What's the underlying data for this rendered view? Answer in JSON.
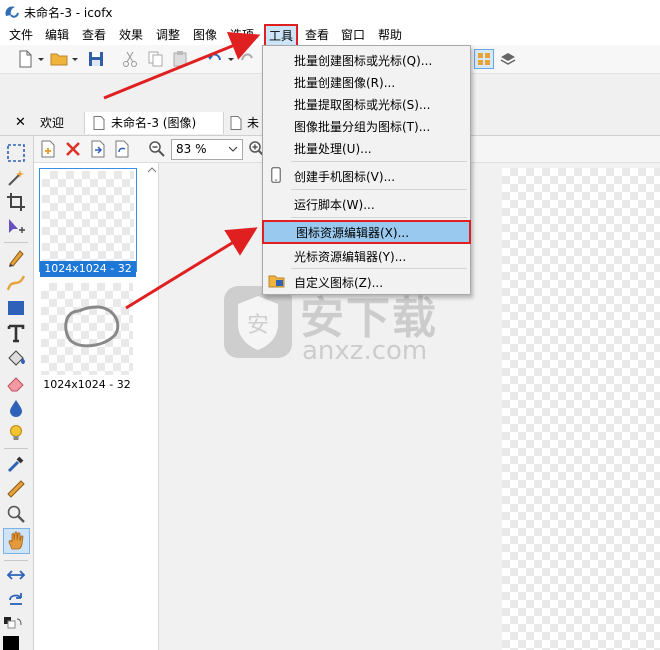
{
  "window": {
    "title": "未命名-3 - icofx"
  },
  "menubar": {
    "items": [
      "文件",
      "编辑",
      "查看",
      "效果",
      "调整",
      "图像",
      "选项",
      "工具",
      "查看",
      "窗口",
      "帮助"
    ]
  },
  "tabs": {
    "close_label": "✕",
    "welcome": "欢迎",
    "doc1": "未命名-3 (图像)",
    "doc2": "未"
  },
  "doc_toolbar": {
    "zoom": "83 %"
  },
  "thumbnails": [
    {
      "label": "1024x1024 - 32"
    },
    {
      "label": "1024x1024 - 32"
    }
  ],
  "dropdown": {
    "items": [
      {
        "label": "批量创建图标或光标(Q)..."
      },
      {
        "label": "批量创建图像(R)..."
      },
      {
        "label": "批量提取图标或光标(S)..."
      },
      {
        "label": "图像批量分组为图标(T)..."
      },
      {
        "label": "批量处理(U)..."
      },
      {
        "label": "创建手机图标(V)..."
      },
      {
        "label": "运行脚本(W)..."
      },
      {
        "label": "图标资源编辑器(X)..."
      },
      {
        "label": "光标资源编辑器(Y)..."
      },
      {
        "label": "自定义图标(Z)..."
      }
    ]
  },
  "watermark": {
    "cn": "安下载",
    "en": "anxz.com"
  },
  "colors": {
    "highlight": "#99c9ef",
    "annotation": "#e02020",
    "accent": "#1a6fd1"
  }
}
